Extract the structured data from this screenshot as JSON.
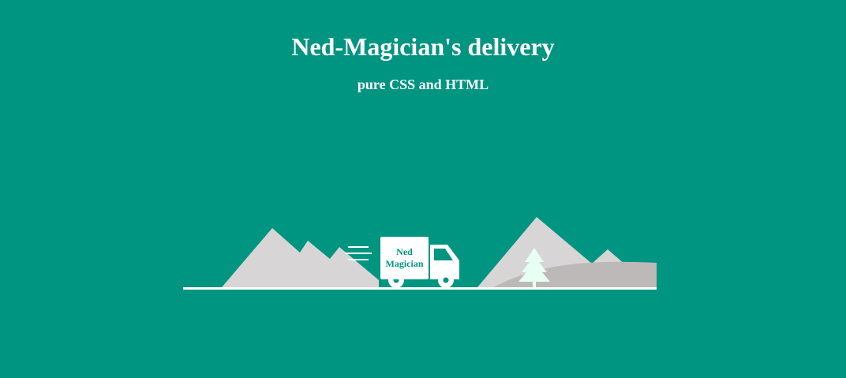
{
  "header": {
    "title": "Ned-Magician's delivery",
    "subtitle": "pure CSS and HTML"
  },
  "truck": {
    "label_line1": "Ned",
    "label_line2": "Magician"
  },
  "colors": {
    "background": "#009580",
    "mountain": "#d7d5d6",
    "hill": "#bdb9b9",
    "tree": "#e8fff3",
    "truck": "#ffffff",
    "ground": "#ffffff"
  }
}
